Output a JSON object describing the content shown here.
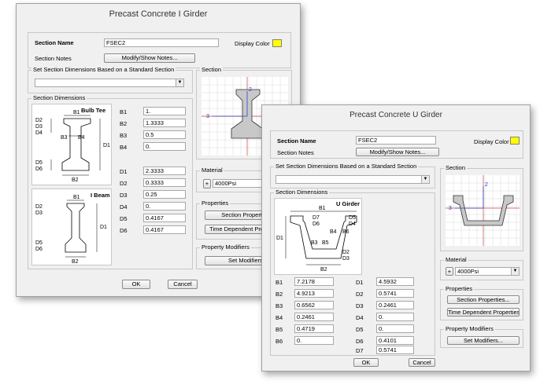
{
  "i_girder": {
    "title": "Precast Concrete I Girder",
    "section_name_label": "Section Name",
    "section_name_value": "FSEC2",
    "display_color_label": "Display Color",
    "display_color": "#ffff00",
    "section_notes_label": "Section Notes",
    "notes_button": "Modify/Show Notes...",
    "standard_group_title": "Set Section Dimensions Based on a Standard Section",
    "standard_value": "",
    "dims_group_title": "Section Dimensions",
    "bulb_tee_title": "Bulb Tee",
    "i_beam_title": "I Beam",
    "fields_upper": [
      {
        "label": "B1",
        "value": "1."
      },
      {
        "label": "B2",
        "value": "1.3333"
      },
      {
        "label": "B3",
        "value": "0.5"
      },
      {
        "label": "B4",
        "value": "0."
      }
    ],
    "fields_lower": [
      {
        "label": "D1",
        "value": "2.3333"
      },
      {
        "label": "D2",
        "value": "0.3333"
      },
      {
        "label": "D3",
        "value": "0.25"
      },
      {
        "label": "D4",
        "value": "0."
      },
      {
        "label": "D5",
        "value": "0.4167"
      },
      {
        "label": "D6",
        "value": "0.4167"
      }
    ],
    "section_group_title": "Section",
    "material_group_title": "Material",
    "material_plus": "+",
    "material_value": "4000Psi",
    "properties_group_title": "Properties",
    "section_properties_button": "Section Properties...",
    "time_dependent_button": "Time Dependent Properties...",
    "modifiers_group_title": "Property Modifiers",
    "set_modifiers_button": "Set Modifiers...",
    "ok_button": "OK",
    "cancel_button": "Cancel"
  },
  "u_girder": {
    "title": "Precast Concrete U Girder",
    "section_name_label": "Section Name",
    "section_name_value": "FSEC2",
    "display_color_label": "Display Color",
    "display_color": "#ffff00",
    "section_notes_label": "Section Notes",
    "notes_button": "Modify/Show Notes...",
    "standard_group_title": "Set Section Dimensions Based on a Standard Section",
    "standard_value": "",
    "dims_group_title": "Section Dimensions",
    "u_girder_title": "U Girder",
    "fields_left": [
      {
        "label": "B1",
        "value": "7.2178"
      },
      {
        "label": "B2",
        "value": "4.9213"
      },
      {
        "label": "B3",
        "value": "0.6562"
      },
      {
        "label": "B4",
        "value": "0.2461"
      },
      {
        "label": "B5",
        "value": "0.4719"
      },
      {
        "label": "B6",
        "value": "0."
      }
    ],
    "fields_right": [
      {
        "label": "D1",
        "value": "4.5932"
      },
      {
        "label": "D2",
        "value": "0.5741"
      },
      {
        "label": "D3",
        "value": "0.2461"
      },
      {
        "label": "D4",
        "value": "0."
      },
      {
        "label": "D5",
        "value": "0."
      },
      {
        "label": "D6",
        "value": "0.4101"
      },
      {
        "label": "D7",
        "value": "0.5741"
      }
    ],
    "section_group_title": "Section",
    "material_group_title": "Material",
    "material_plus": "+",
    "material_value": "4000Psi",
    "properties_group_title": "Properties",
    "section_properties_button": "Section Properties...",
    "time_dependent_button": "Time Dependent Properties...",
    "modifiers_group_title": "Property Modifiers",
    "set_modifiers_button": "Set Modifiers...",
    "ok_button": "OK",
    "cancel_button": "Cancel"
  },
  "diagram_labels": {
    "bulb": [
      "B1",
      "D2",
      "D3",
      "D4",
      "B3",
      "B4",
      "D1",
      "D5",
      "D6",
      "B2"
    ],
    "ibeam": [
      "B1",
      "D2",
      "D3",
      "D1",
      "D5",
      "D6",
      "B2"
    ],
    "ugirder": [
      "B1",
      "D7",
      "D6",
      "D5",
      "D4",
      "B4",
      "B6",
      "D1",
      "B3",
      "B5",
      "D2",
      "D3",
      "B2"
    ],
    "axis_2": "2",
    "axis_3": "3"
  }
}
